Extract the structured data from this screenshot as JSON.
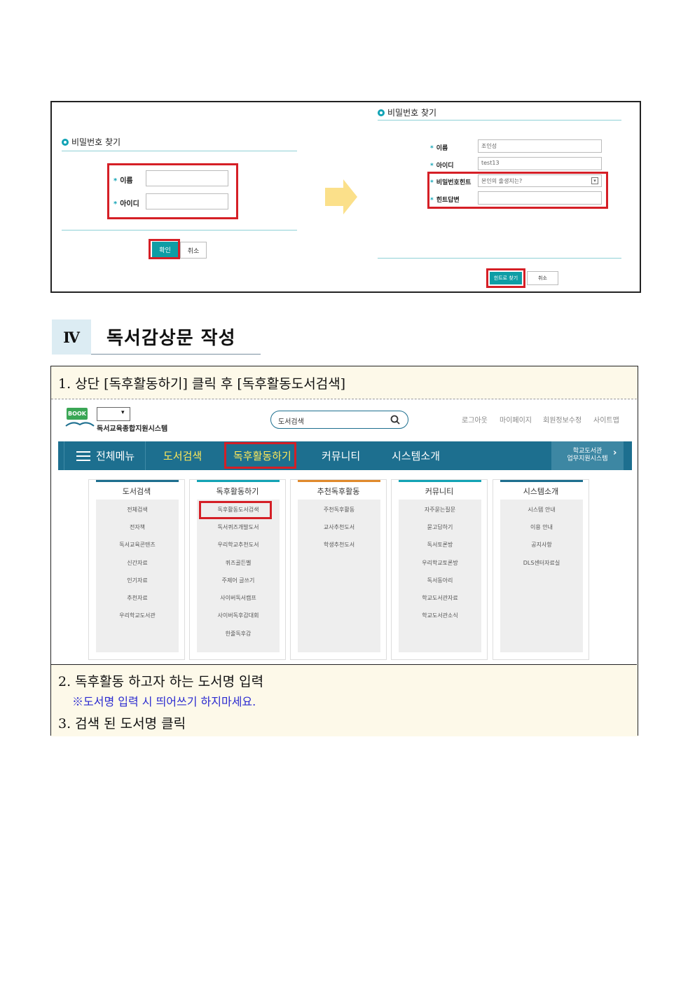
{
  "left_form": {
    "heading": "비밀번호 찾기",
    "name_label": "이름",
    "id_label": "아이디",
    "confirm_label": "확인",
    "cancel_label": "취소"
  },
  "right_form": {
    "heading": "비밀번호 찾기",
    "name_label": "이름",
    "name_value": "조인성",
    "id_label": "아이디",
    "id_value": "test13",
    "hint_label": "비밀번호힌트",
    "hint_value": "본인의 출생지는?",
    "answer_label": "힌트답변",
    "find_label": "힌트로 찾기",
    "cancel_label": "취소"
  },
  "section": {
    "number": "Ⅳ",
    "title": "독서감상문 작성"
  },
  "steps": {
    "step1": "1. 상단 [독후활동하기] 클릭 후 [독후활동도서검색]",
    "step2": "2. 독후활동 하고자 하는 도서명 입력",
    "note": "※도서명 입력 시 띄어쓰기 하지마세요.",
    "step3": "3. 검색 된 도서명 클릭"
  },
  "dls": {
    "logo_badge": "BOOK",
    "logo_text": "독서교육종합지원시스템",
    "search_placeholder": "도서검색",
    "top_links": [
      "로그아웃",
      "마이페이지",
      "회원정보수정",
      "사이트맵"
    ],
    "nav": {
      "all_menu": "전체메뉴",
      "items": [
        "도서검색",
        "독후활동하기",
        "커뮤니티",
        "시스템소개"
      ],
      "right_line1": "학교도서관",
      "right_line2": "업무지원시스템"
    },
    "columns": [
      {
        "title": "도서검색",
        "items": [
          "전체검색",
          "전자책",
          "독서교육콘텐츠",
          "신간자료",
          "인기자료",
          "추천자료",
          "우리학교도서관"
        ]
      },
      {
        "title": "독후활동하기",
        "items": [
          "독후활동도서검색",
          "독서퀴즈개발도서",
          "우리학교추천도서",
          "퀴즈골든벨",
          "주제어 글쓰기",
          "사이버독서캠프",
          "사이버독후감대회",
          "한줄독후감"
        ]
      },
      {
        "title": "추천독후활동",
        "items": [
          "주천독후활동",
          "교사추천도서",
          "학생추천도서"
        ]
      },
      {
        "title": "커뮤니티",
        "items": [
          "자주묻는질문",
          "묻고답하기",
          "독서토론방",
          "우리학교토론방",
          "독서동아리",
          "학교도서관자료",
          "학교도서관소식"
        ]
      },
      {
        "title": "시스템소개",
        "items": [
          "시스템 안내",
          "이용 안내",
          "공지사항",
          "DLS센터자료실"
        ]
      }
    ],
    "colors": {
      "nav": "#1d6f8f",
      "accent_teal": "#12a3b5",
      "highlight_yellow": "#ffe95a",
      "red_box": "#d51f26"
    }
  }
}
